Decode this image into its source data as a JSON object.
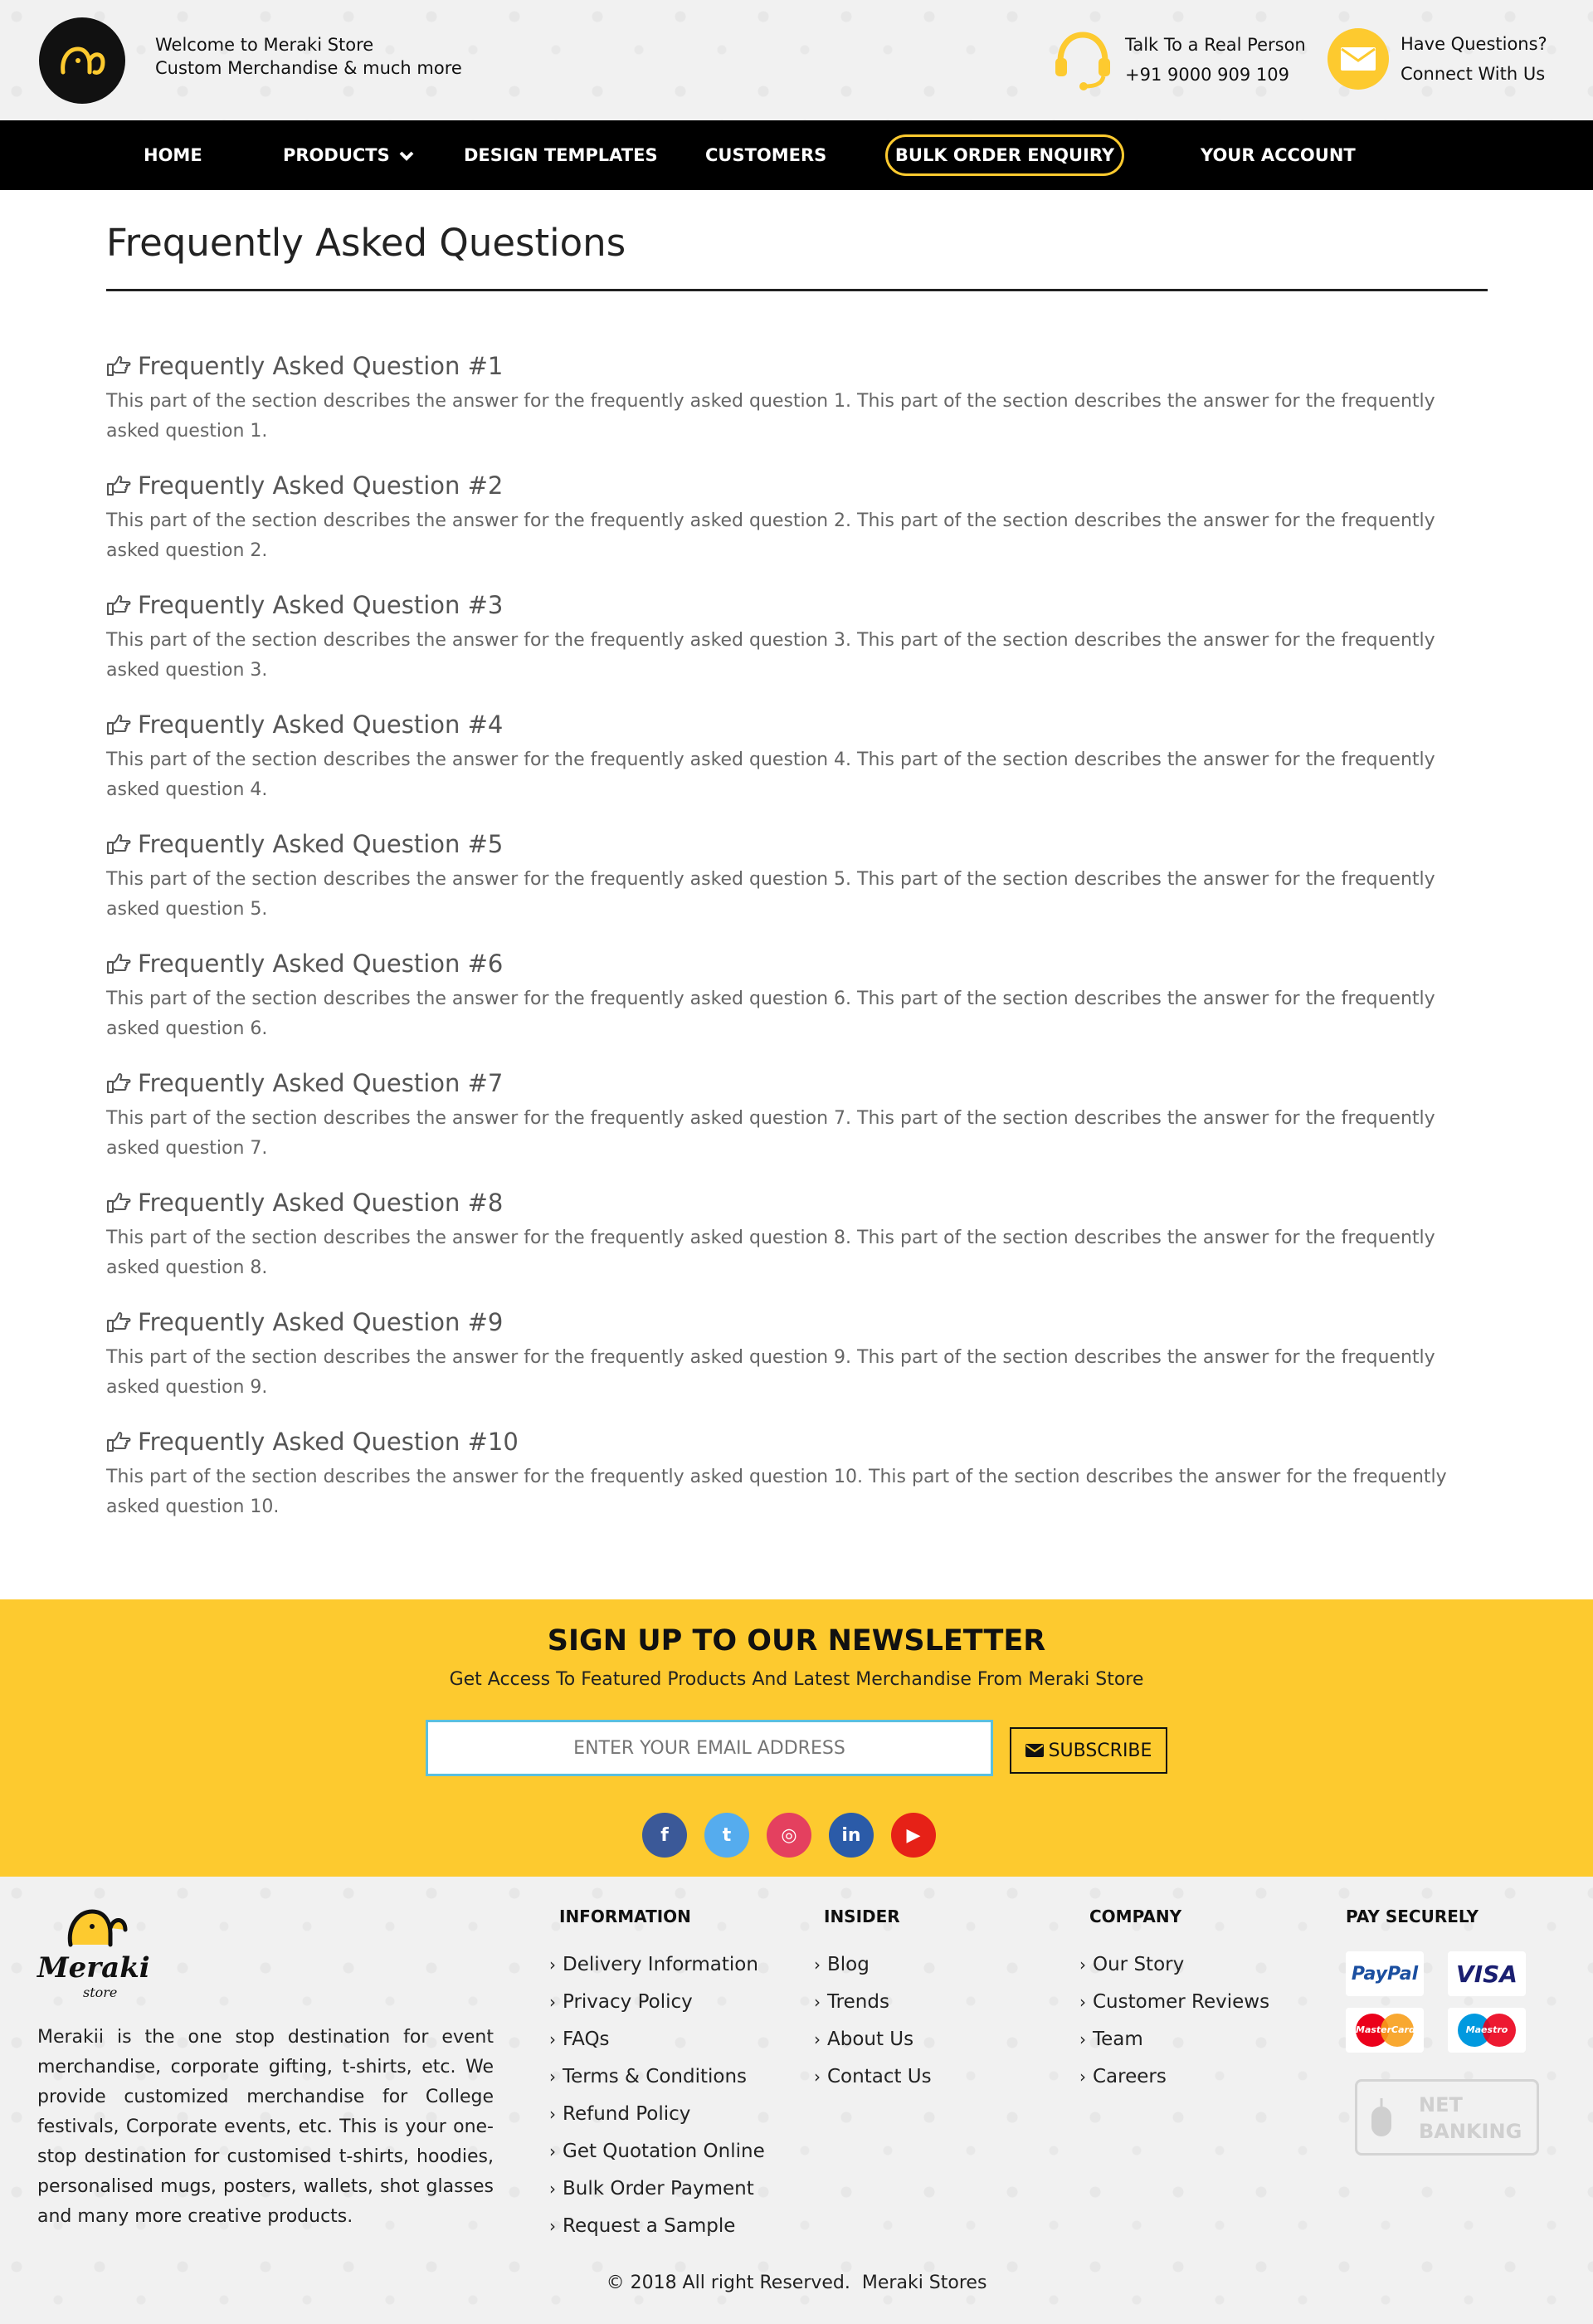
{
  "header": {
    "welcome_line1": "Welcome to Meraki Store",
    "welcome_line2": "Custom Merchandise & much more",
    "phone_label": "Talk To a Real Person",
    "phone_number": "+91 9000 909 109",
    "questions_label": "Have Questions?",
    "questions_sub": "Connect With Us"
  },
  "nav": {
    "home": "HOME",
    "products": "PRODUCTS",
    "design_templates": "DESIGN TEMPLATES",
    "customers": "CUSTOMERS",
    "bulk_order": "BULK ORDER ENQUIRY",
    "account": "YOUR ACCOUNT"
  },
  "faq": {
    "title": "Frequently Asked Questions",
    "items": [
      {
        "q": "Frequently Asked Question #1",
        "a": "This part of the section describes the answer for the frequently asked question 1. This part of the section describes the answer for the frequently asked question 1."
      },
      {
        "q": "Frequently Asked Question #2",
        "a": "This part of the section describes the answer for the frequently asked question 2. This part of the section describes the answer for the frequently asked question 2."
      },
      {
        "q": "Frequently Asked Question #3",
        "a": "This part of the section describes the answer for the frequently asked question 3. This part of the section describes the answer for the frequently asked question 3."
      },
      {
        "q": "Frequently Asked Question #4",
        "a": "This part of the section describes the answer for the frequently asked question 4. This part of the section describes the answer for the frequently asked question 4."
      },
      {
        "q": "Frequently Asked Question #5",
        "a": "This part of the section describes the answer for the frequently asked question 5. This part of the section describes the answer for the frequently asked question 5."
      },
      {
        "q": "Frequently Asked Question #6",
        "a": "This part of the section describes the answer for the frequently asked question 6. This part of the section describes the answer for the frequently asked question 6."
      },
      {
        "q": "Frequently Asked Question #7",
        "a": "This part of the section describes the answer for the frequently asked question 7. This part of the section describes the answer for the frequently asked question 7."
      },
      {
        "q": "Frequently Asked Question #8",
        "a": "This part of the section describes the answer for the frequently asked question 8. This part of the section describes the answer for the frequently asked question 8."
      },
      {
        "q": "Frequently Asked Question #9",
        "a": "This part of the section describes the answer for the frequently asked question 9. This part of the section describes the answer for the frequently asked question 9."
      },
      {
        "q": "Frequently Asked Question #10",
        "a": "This part of the section describes the answer for the frequently asked question 10. This part of the section describes the answer for the frequently asked question 10."
      }
    ]
  },
  "newsletter": {
    "title": "SIGN UP TO OUR NEWSLETTER",
    "subtitle": "Get Access To Featured Products And Latest Merchandise From Meraki Store",
    "email_placeholder": "ENTER YOUR EMAIL ADDRESS",
    "subscribe_label": "SUBSCRIBE",
    "social": [
      {
        "name": "facebook-icon",
        "glyph": "f",
        "color": "#3b5998"
      },
      {
        "name": "twitter-icon",
        "glyph": "t",
        "color": "#55acee"
      },
      {
        "name": "instagram-icon",
        "glyph": "◎",
        "color": "#e4405f"
      },
      {
        "name": "linkedin-icon",
        "glyph": "in",
        "color": "#2b5ba8"
      },
      {
        "name": "youtube-icon",
        "glyph": "▶",
        "color": "#e62117"
      }
    ]
  },
  "footer": {
    "logo_text": "Meraki",
    "logo_sub": "store",
    "about": "Merakii is the one stop destination for event merchandise, corporate gifting, t-shirts, etc. We provide customized merchandise for College festivals, Corporate events, etc. This is your one-stop destination for customised t-shirts, hoodies, personalised mugs, posters, wallets, shot glasses and many more creative products.",
    "information": {
      "heading": "INFORMATION",
      "links": [
        "Delivery Information",
        "Privacy Policy",
        "FAQs",
        "Terms & Conditions",
        "Refund Policy",
        "Get Quotation Online",
        "Bulk Order Payment",
        "Request a Sample"
      ]
    },
    "insider": {
      "heading": "INSIDER",
      "links": [
        "Blog",
        "Trends",
        "About Us",
        "Contact Us"
      ]
    },
    "company": {
      "heading": "COMPANY",
      "links": [
        "Our Story",
        "Customer Reviews",
        "Team",
        "Careers"
      ]
    },
    "pay": {
      "heading": "PAY SECURELY",
      "paypal": "PayPal",
      "visa": "VISA",
      "mastercard": "MasterCard",
      "maestro": "Maestro",
      "netbanking_1": "NET",
      "netbanking_2": "BANKING"
    },
    "copyright_prefix": "© 2018 All right Reserved.",
    "copyright_brand": "Meraki Stores"
  }
}
